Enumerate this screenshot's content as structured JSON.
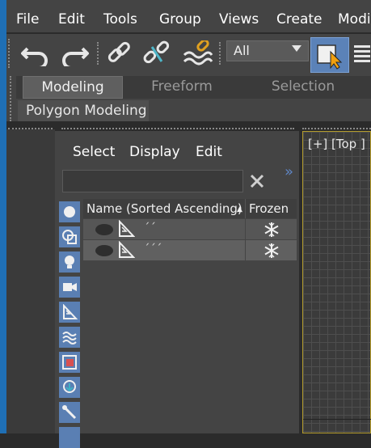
{
  "menubar": {
    "items": [
      "File",
      "Edit",
      "Tools",
      "Group",
      "Views",
      "Create",
      "Modifi"
    ]
  },
  "toolbar": {
    "selection_filter": "All",
    "icons": [
      "undo-icon",
      "redo-icon",
      "link-icon",
      "unlink-icon",
      "bind-space-warp-icon",
      "select-object-icon",
      "select-by-name-icon"
    ]
  },
  "ribbon": {
    "tabs": [
      "Modeling",
      "Freeform",
      "Selection"
    ],
    "active_tab": "Modeling",
    "panel_label": "Polygon Modeling"
  },
  "scene_explorer": {
    "menus": [
      "Select",
      "Display",
      "Edit"
    ],
    "search": {
      "value": "",
      "placeholder": ""
    },
    "columns": {
      "name": "Name (Sorted Ascending)",
      "sort_indicator": "▲",
      "frozen": "Frozen"
    },
    "rows": [
      {
        "name": "´´",
        "frozen_icon": "snowflake-icon"
      },
      {
        "name": "´´´",
        "frozen_icon": "snowflake-icon"
      }
    ],
    "collapse_glyph": "»"
  },
  "viewport": {
    "label": "[+] [Top ]"
  },
  "colors": {
    "accent_blue": "#1f6fb5",
    "filter_button_blue": "#5a7fb3",
    "viewport_border": "#b29a2b"
  }
}
